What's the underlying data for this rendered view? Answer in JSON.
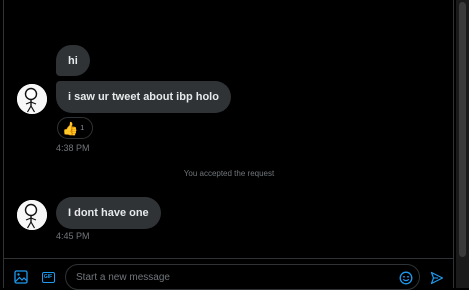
{
  "conversation": {
    "messages": [
      {
        "text": "hi"
      },
      {
        "text": "i saw ur tweet about ibp holo"
      },
      {
        "text": "I dont have one"
      }
    ],
    "reaction": {
      "emoji": "👍",
      "count": "1"
    },
    "timestamps": [
      "4:38 PM",
      "4:45 PM"
    ],
    "system_notice": "You accepted the request"
  },
  "composer": {
    "placeholder": "Start a new message",
    "gif_label": "GIF",
    "icons": [
      "image-icon",
      "gif-icon",
      "emoji-icon",
      "send-icon"
    ]
  },
  "colors": {
    "background": "#000000",
    "bubble": "#2f3336",
    "accent": "#1d9bf0",
    "muted_text": "#71767b"
  }
}
